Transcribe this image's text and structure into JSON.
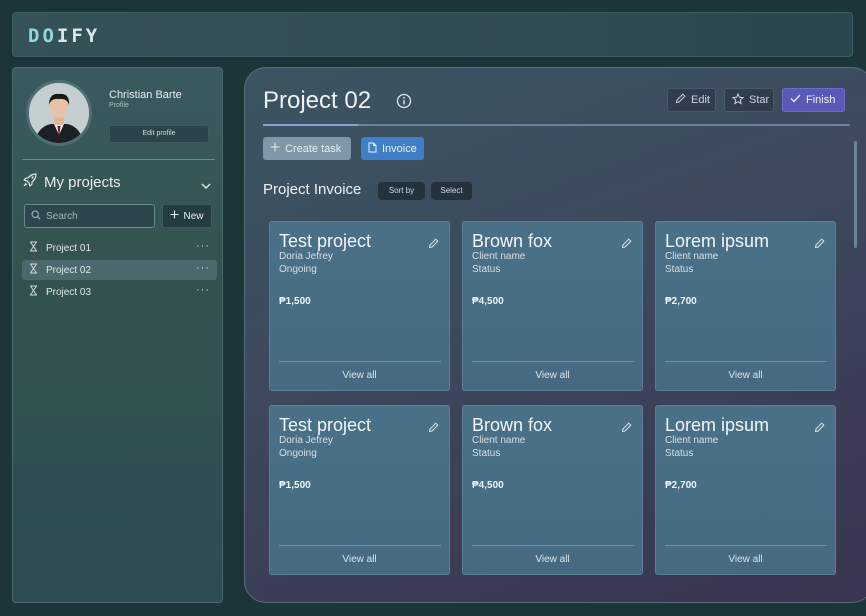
{
  "app": {
    "logo_prefix": "DO",
    "logo_suffix": "IFY"
  },
  "profile": {
    "name": "Christian Barte",
    "role": "Profile",
    "edit_label": "Edit profile"
  },
  "sidebar": {
    "section_label": "My projects",
    "search_placeholder": "Search",
    "new_label": "New",
    "projects": [
      {
        "label": "Project 01",
        "active": false
      },
      {
        "label": "Project 02",
        "active": true
      },
      {
        "label": "Project 03",
        "active": false
      }
    ],
    "more_glyph": "···"
  },
  "main": {
    "title": "Project 02",
    "edit_label": "Edit",
    "star_label": "Star",
    "finish_label": "Finish",
    "create_task_label": "Create task",
    "invoice_label": "Invoice",
    "section_title": "Project Invoice",
    "sort_label": "Sort by",
    "select_label": "Select"
  },
  "cards": [
    {
      "title": "Test project",
      "client": "Doria Jefrey",
      "status": "Ongoing",
      "amount": "₱1,500",
      "link": "View all"
    },
    {
      "title": "Brown fox",
      "client": "Client name",
      "status": "Status",
      "amount": "₱4,500",
      "link": "View all"
    },
    {
      "title": "Lorem ipsum",
      "client": "Client name",
      "status": "Status",
      "amount": "₱2,700",
      "link": "View all"
    },
    {
      "title": "Test project",
      "client": "Doria Jefrey",
      "status": "Ongoing",
      "amount": "₱1,500",
      "link": "View all"
    },
    {
      "title": "Brown fox",
      "client": "Client name",
      "status": "Status",
      "amount": "₱4,500",
      "link": "View all"
    },
    {
      "title": "Lorem ipsum",
      "client": "Client name",
      "status": "Status",
      "amount": "₱2,700",
      "link": "View all"
    }
  ],
  "colors": {
    "accent": "#5b59b8",
    "invoice": "#3f7fc7",
    "card": "#4a7188"
  },
  "icons": [
    "rocket-icon",
    "chevron-down-icon",
    "search-icon",
    "plus-icon",
    "hourglass-icon",
    "info-icon",
    "pencil-icon",
    "star-icon",
    "check-icon",
    "file-icon"
  ]
}
